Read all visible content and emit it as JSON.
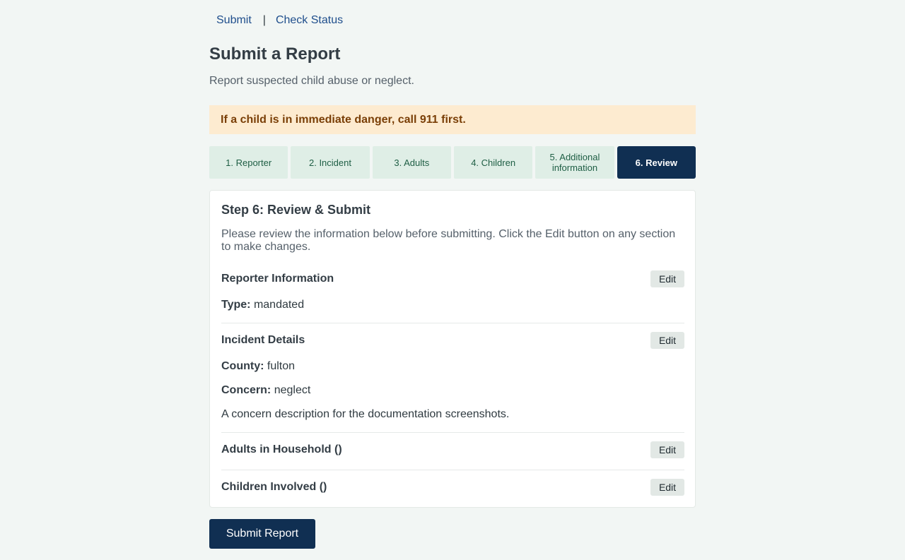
{
  "nav": {
    "submit": "Submit",
    "separator": "|",
    "check_status": "Check Status"
  },
  "page": {
    "title": "Submit a Report",
    "subtitle": "Report suspected child abuse or neglect."
  },
  "alert": {
    "text": "If a child is in immediate danger, call 911 first."
  },
  "steps": [
    {
      "label": "1. Reporter",
      "active": false
    },
    {
      "label": "2. Incident",
      "active": false
    },
    {
      "label": "3. Adults",
      "active": false
    },
    {
      "label": "4. Children",
      "active": false
    },
    {
      "label": "5. Additional information",
      "active": false
    },
    {
      "label": "6. Review",
      "active": true
    }
  ],
  "review": {
    "heading": "Step 6: Review & Submit",
    "intro": "Please review the information below before submitting. Click the Edit button on any section to make changes.",
    "edit_label": "Edit",
    "reporter": {
      "title": "Reporter Information",
      "type_label": "Type:",
      "type_value": "mandated"
    },
    "incident": {
      "title": "Incident Details",
      "county_label": "County:",
      "county_value": "fulton",
      "concern_label": "Concern:",
      "concern_value": "neglect",
      "description": "A concern description for the documentation screenshots."
    },
    "adults": {
      "title": "Adults in Household ()"
    },
    "children": {
      "title": "Children Involved ()"
    }
  },
  "submit_button": "Submit Report",
  "colors": {
    "background": "#f2f6f4",
    "primary": "#102f52",
    "link": "#1f4e8c",
    "alert_bg": "#fdebd0",
    "alert_text": "#7a3f07",
    "step_bg": "#dfeee6",
    "step_text": "#1e5e44"
  }
}
